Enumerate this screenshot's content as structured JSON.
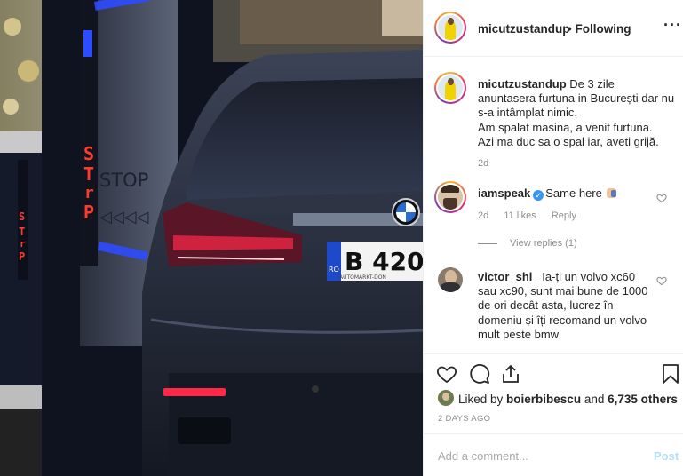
{
  "header": {
    "username": "micutzustandup",
    "follow_status": "• Following",
    "more_icon": "more-horizontal-icon"
  },
  "caption": {
    "username": "micutzustandup",
    "text_line1": "De 3 zile anuntasera furtuna in București dar nu s-a intâmplat nimic.",
    "text_line2": "Am spalat masina, a venit furtuna.",
    "text_line3": "Azi ma duc sa o spal iar, aveti grijă.",
    "time": "2d"
  },
  "comments": [
    {
      "username": "iamspeak",
      "verified": true,
      "text": "Same here",
      "time": "2d",
      "likes": "11 likes",
      "reply": "Reply",
      "view_replies": "View replies (1)"
    },
    {
      "username": "victor_shl_",
      "verified": false,
      "text": "Ia-ți un volvo xc60 sau xc90, sunt mai bune de 1000 de ori decât asta, lucrez în domeniu și îți recomand un volvo mult peste bmw"
    }
  ],
  "likes": {
    "prefix": "Liked by ",
    "user": "boierbibescu",
    "middle": " and ",
    "others": "6,735 others"
  },
  "post_time": "2 DAYS AGO",
  "add_comment": {
    "placeholder": "Add a comment...",
    "post_label": "Post"
  },
  "photo": {
    "plate_country": "RO",
    "plate_text": "B 420",
    "plate_dealer": "AUTOMARKT-DON",
    "sign_text": "STOP",
    "neon_letters": [
      "S",
      "T",
      "r",
      "P"
    ]
  },
  "colors": {
    "accent_blue": "#3897f0",
    "post_button": "#b2dffc",
    "secondary_text": "#8e8e8e",
    "neon_red": "#ff3b2f",
    "neon_blue": "#2d4bff"
  }
}
